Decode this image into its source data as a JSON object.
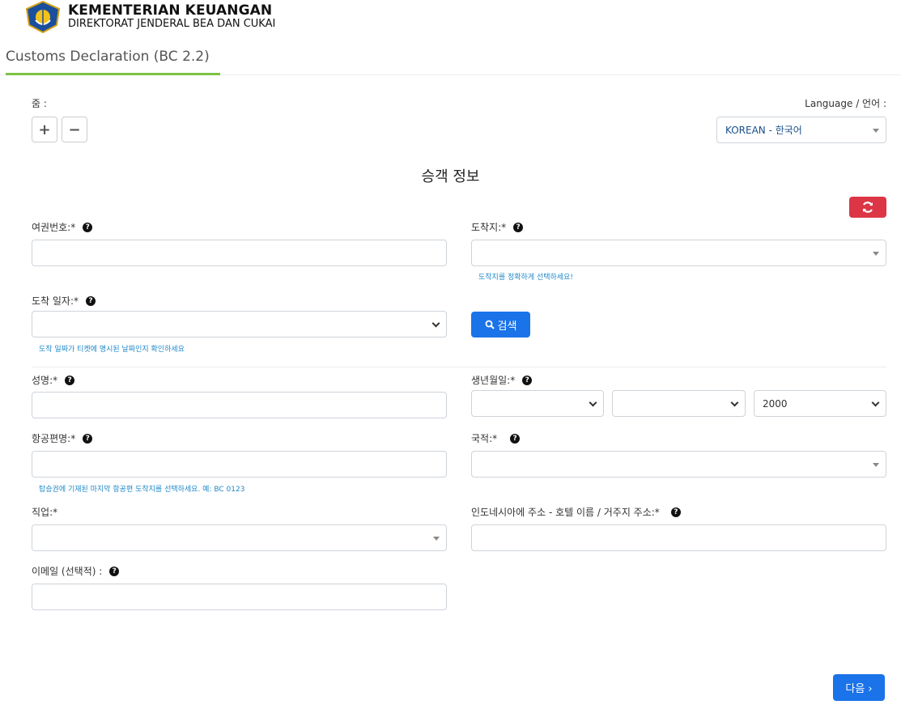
{
  "header": {
    "org_line1": "KEMENTERIAN KEUANGAN",
    "org_line2": "DIREKTORAT JENDERAL BEA DAN CUKAI",
    "tab": "Customs Declaration (BC 2.2)"
  },
  "zoom": {
    "label": "줌 :",
    "plus": "+",
    "minus": "−"
  },
  "language": {
    "label": "Language / 언어 :",
    "selected": "KOREAN - 한국어"
  },
  "section_title": "승객 정보",
  "form": {
    "passport": {
      "label": "여권번호:*",
      "value": ""
    },
    "destination": {
      "label": "도착지:*",
      "value": "",
      "hint": "도착지를 정확하게 선택하세요!"
    },
    "arrival_date": {
      "label": "도착 일자:*",
      "value": "",
      "hint": "도착 일짜가 티켓에 명시된 날짜인지 확인하세요"
    },
    "search_button": "검색",
    "name": {
      "label": "성명:*",
      "value": ""
    },
    "birthdate": {
      "label": "생년월일:*",
      "day": "",
      "month": "",
      "year": "2000"
    },
    "flight": {
      "label": "항공편명:*",
      "value": "",
      "hint": "탑승권에 기재된 마지막 항공편 도착지를 선택하세요. 예: BC 0123"
    },
    "nationality": {
      "label": "국적:*",
      "value": ""
    },
    "occupation": {
      "label": "직업:*",
      "value": ""
    },
    "address": {
      "label": "인도네시아에 주소 - 호텔 이름 / 거주지 주소:*",
      "value": ""
    },
    "email": {
      "label": "이메일 (선택적) :",
      "value": ""
    }
  },
  "next_button": "다음 ›",
  "colors": {
    "accent_green": "#7cc242",
    "primary_blue": "#1a73e8",
    "danger_red": "#dc3545",
    "hint_blue": "#1e88c9"
  }
}
